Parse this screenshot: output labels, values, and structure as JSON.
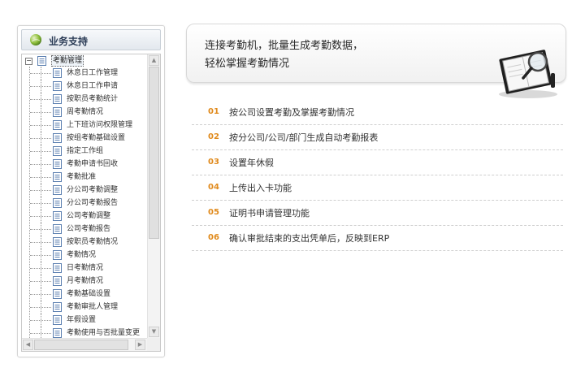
{
  "sidebar": {
    "title": "业务支持",
    "root_label": "考勤管理",
    "items": [
      "休息日工作管理",
      "休息日工作申请",
      "按职员考勤统计",
      "周考勤情况",
      "上下班访问权限管理",
      "按组考勤基础设置",
      "指定工作组",
      "考勤申请书回收",
      "考勤批准",
      "分公司考勤调整",
      "分公司考勤报告",
      "公司考勤调整",
      "公司考勤报告",
      "按职员考勤情况",
      "考勤情况",
      "日考勤情况",
      "月考勤情况",
      "考勤基础设置",
      "考勤审批人管理",
      "年假设置",
      "考勤使用与否批量变更"
    ]
  },
  "banner": {
    "line1": "连接考勤机，批量生成考勤数据，",
    "line2": "轻松掌握考勤情况"
  },
  "features": [
    {
      "num": "01",
      "text": "按公司设置考勤及掌握考勤情况"
    },
    {
      "num": "02",
      "text": "按分公司/公司/部门生成自动考勤报表"
    },
    {
      "num": "03",
      "text": "设置年休假"
    },
    {
      "num": "04",
      "text": "上传出入卡功能"
    },
    {
      "num": "05",
      "text": "证明书申请管理功能"
    },
    {
      "num": "06",
      "text": "确认审批结束的支出凭单后，反映到ERP"
    }
  ],
  "colors": {
    "accent_number": "#e08a1c",
    "panel_title": "#2a3b55"
  },
  "icons": {
    "panel": "globe-icon",
    "tree_node": "document-icon",
    "banner": "notebook-magnifier-icon"
  }
}
